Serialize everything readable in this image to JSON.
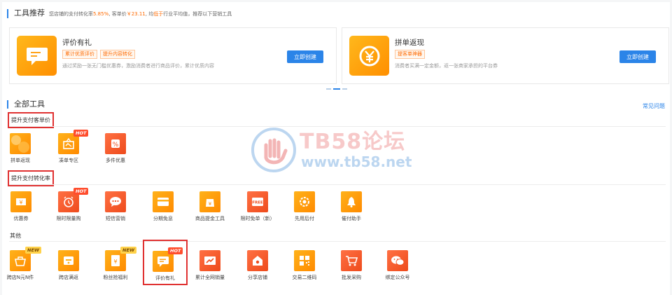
{
  "recommend": {
    "title": "工具推荐",
    "subtitle_pre": "您店铺的支付转化率",
    "conversion_rate": "5.85%",
    "subtitle_mid": ", 客单价",
    "avg_price": "￥23.11",
    "subtitle_mid2": ", 均",
    "compare": "低于",
    "subtitle_post": "行业平均值，推荐以下营销工具",
    "cards": [
      {
        "name": "评价有礼",
        "tags": [
          "累计优质评价",
          "提升内容转化"
        ],
        "desc": "通过奖励一张无门槛优惠券，激励消费者进行商品评价，累计优质内容",
        "button": "立即创建",
        "icon": "message-icon"
      },
      {
        "name": "拼单返现",
        "tags": [
          "提客单神器"
        ],
        "desc": "消费者买满一定金额，返一张商家承担的平台券",
        "button": "立即创建",
        "icon": "yen-coin-icon"
      }
    ]
  },
  "all_tools": {
    "title": "全部工具",
    "faq_link": "常见问题",
    "groups": [
      {
        "label": "提升支付客单价",
        "tools": [
          {
            "name": "拼单返现",
            "icon": "yen-coin-icon",
            "badge": ""
          },
          {
            "name": "凑单专区",
            "icon": "gift-box-icon",
            "badge": "HOT"
          },
          {
            "name": "多件优惠",
            "icon": "discount-tag-icon",
            "badge": ""
          }
        ]
      },
      {
        "label": "提升支付转化率",
        "tools": [
          {
            "name": "优惠券",
            "icon": "coupon-icon",
            "badge": ""
          },
          {
            "name": "限时限量购",
            "icon": "alarm-clock-icon",
            "badge": "HOT"
          },
          {
            "name": "短信营销",
            "icon": "chat-bubble-icon",
            "badge": ""
          },
          {
            "name": "分期免息",
            "icon": "credit-card-icon",
            "badge": ""
          },
          {
            "name": "商品提金工具",
            "icon": "gold-bag-icon",
            "badge": ""
          },
          {
            "name": "限时免单（新）",
            "icon": "free-tag-icon",
            "badge": ""
          },
          {
            "name": "先用后付",
            "icon": "gear-badge-icon",
            "badge": ""
          },
          {
            "name": "催付助手",
            "icon": "bell-icon",
            "badge": ""
          }
        ]
      },
      {
        "label": "其他",
        "tools": [
          {
            "name": "跨店N元N件",
            "icon": "basket-icon",
            "badge": "NEW"
          },
          {
            "name": "跨店满返",
            "icon": "gift-card-icon",
            "badge": ""
          },
          {
            "name": "粉丝抢福利",
            "icon": "red-envelope-icon",
            "badge": "NEW"
          },
          {
            "name": "评价有礼",
            "icon": "message-icon",
            "badge": "HOT"
          },
          {
            "name": "累计全网销量",
            "icon": "trend-chart-icon",
            "badge": ""
          },
          {
            "name": "分享店铺",
            "icon": "share-store-icon",
            "badge": ""
          },
          {
            "name": "交易二维码",
            "icon": "qr-code-icon",
            "badge": ""
          },
          {
            "name": "批发采购",
            "icon": "shopping-cart-icon",
            "badge": ""
          },
          {
            "name": "绑定公众号",
            "icon": "wechat-icon",
            "badge": ""
          }
        ]
      }
    ]
  },
  "watermark": {
    "line1": "TB58论坛",
    "line2": "www.tb58.net"
  }
}
